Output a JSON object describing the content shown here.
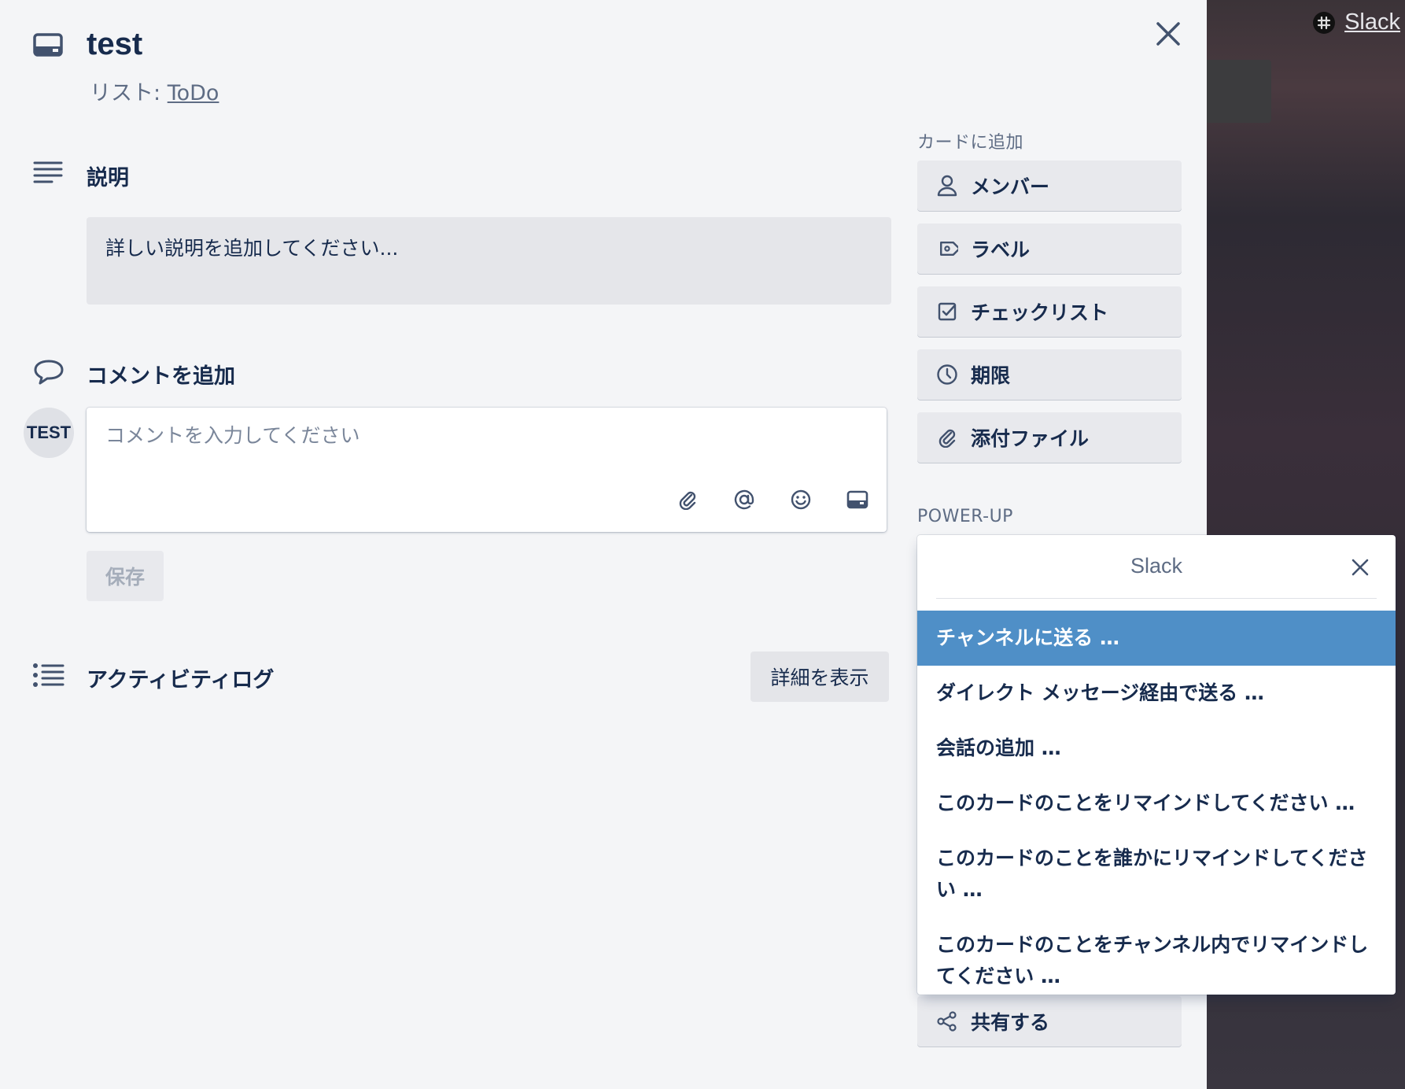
{
  "background": {
    "slack_link": "Slack"
  },
  "card": {
    "title": "test",
    "list_prefix": "リスト: ",
    "list_name": "ToDo"
  },
  "description": {
    "heading": "説明",
    "placeholder": "詳しい説明を追加してください..."
  },
  "comment": {
    "heading": "コメントを追加",
    "avatar_initials": "TEST",
    "placeholder": "コメントを入力してください",
    "save_label": "保存"
  },
  "activity": {
    "heading": "アクティビティログ",
    "details_label": "詳細を表示"
  },
  "sidebar": {
    "add_to_card_label": "カードに追加",
    "add_buttons": [
      {
        "label": "メンバー",
        "icon": "person-icon"
      },
      {
        "label": "ラベル",
        "icon": "tag-icon"
      },
      {
        "label": "チェックリスト",
        "icon": "checkbox-icon"
      },
      {
        "label": "期限",
        "icon": "clock-icon"
      },
      {
        "label": "添付ファイル",
        "icon": "paperclip-icon"
      }
    ],
    "powerup_label": "POWER-UP",
    "share_label": "共有する"
  },
  "slack_popover": {
    "title": "Slack",
    "items": [
      "チャンネルに送る …",
      "ダイレクト メッセージ経由で送る …",
      "会話の追加 …",
      "このカードのことをリマインドしてください …",
      "このカードのことを誰かにリマインドしてください …",
      "このカードのことをチャンネル内でリマインドしてください …"
    ]
  },
  "colors": {
    "modal_bg": "#f4f5f7",
    "text": "#172b4d",
    "muted": "#5e6c84",
    "active_item": "#4f8fc7"
  }
}
